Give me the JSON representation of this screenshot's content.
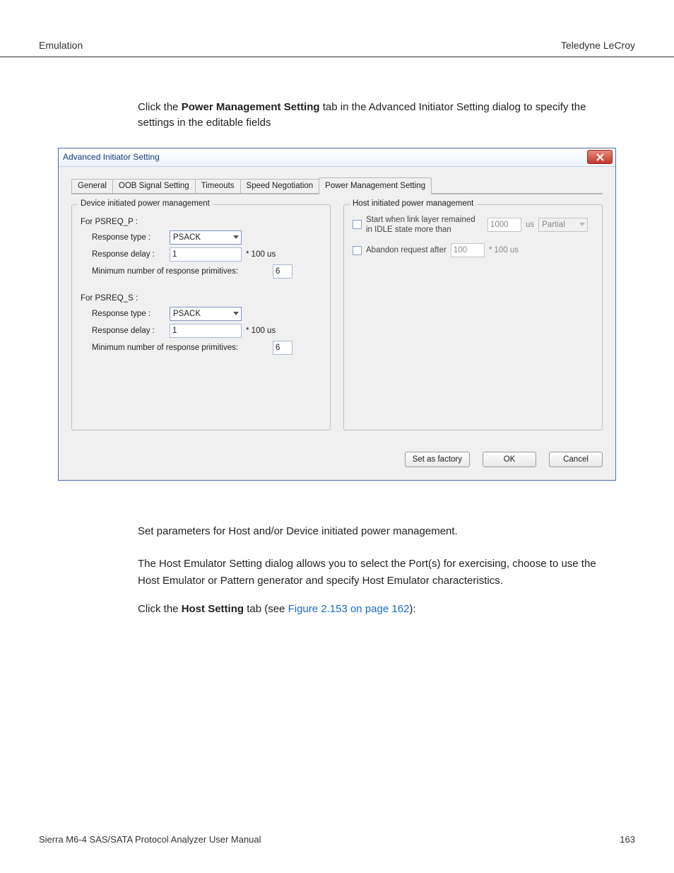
{
  "header": {
    "left": "Emulation",
    "right": "Teledyne LeCroy"
  },
  "intro": {
    "pre": "Click the ",
    "bold": "Power Management Setting",
    "post": " tab in the Advanced Initiator Setting dialog to specify the settings in the editable fields"
  },
  "dialog": {
    "title": "Advanced Initiator Setting",
    "tabs": {
      "general": "General",
      "oob": "OOB Signal Setting",
      "timeouts": "Timeouts",
      "speed": "Speed Negotiation",
      "power": "Power Management Setting"
    },
    "device_group": {
      "legend": "Device initiated power management",
      "psreq_p": {
        "header": "For PSREQ_P :",
        "resp_type_lbl": "Response type :",
        "resp_type_val": "PSACK",
        "resp_delay_lbl": "Response delay :",
        "resp_delay_val": "1",
        "resp_delay_units": "* 100 us",
        "min_prim_lbl": "Minimum number of response primitives:",
        "min_prim_val": "6"
      },
      "psreq_s": {
        "header": "For PSREQ_S :",
        "resp_type_lbl": "Response type :",
        "resp_type_val": "PSACK",
        "resp_delay_lbl": "Response delay :",
        "resp_delay_val": "1",
        "resp_delay_units": "* 100 us",
        "min_prim_lbl": "Minimum number of response primitives:",
        "min_prim_val": "6"
      }
    },
    "host_group": {
      "legend": "Host initiated power management",
      "start_lbl": "Start when link layer remained in IDLE state more than",
      "start_val": "1000",
      "start_units": "us",
      "start_mode": "Partial",
      "abandon_lbl": "Abandon request after",
      "abandon_val": "100",
      "abandon_units": "* 100 us"
    },
    "buttons": {
      "factory": "Set as factory",
      "ok": "OK",
      "cancel": "Cancel"
    }
  },
  "post": {
    "p1": "Set parameters for Host and/or Device initiated power management.",
    "p2": "The Host Emulator Setting dialog allows you to select the Port(s) for exercising, choose to use the Host Emulator or Pattern generator and specify Host Emulator characteristics.",
    "p3_pre": "Click the ",
    "p3_bold": "Host Setting",
    "p3_mid": " tab (see ",
    "p3_link": "Figure 2.153 on page 162",
    "p3_post": "):"
  },
  "footer": {
    "left": "Sierra M6-4 SAS/SATA Protocol Analyzer User Manual",
    "right": "163"
  }
}
